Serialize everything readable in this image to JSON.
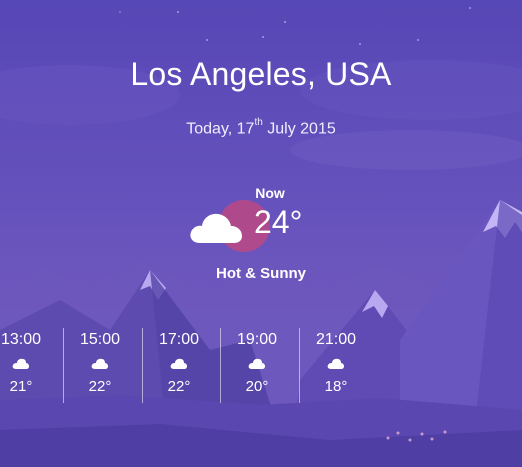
{
  "location": {
    "city": "Los Angeles, USA"
  },
  "date": {
    "prefix": "Today, 17",
    "suffix": "th",
    "rest": " July 2015"
  },
  "current": {
    "label": "Now",
    "temperature": "24°",
    "condition": "Hot & Sunny",
    "icon": "cloud-icon"
  },
  "hourly": [
    {
      "time": "13:00",
      "temp": "21°",
      "icon": "cloud-icon"
    },
    {
      "time": "15:00",
      "temp": "22°",
      "icon": "cloud-icon"
    },
    {
      "time": "17:00",
      "temp": "22°",
      "icon": "cloud-icon"
    },
    {
      "time": "19:00",
      "temp": "20°",
      "icon": "cloud-icon"
    },
    {
      "time": "21:00",
      "temp": "18°",
      "icon": "cloud-icon"
    }
  ],
  "colors": {
    "sky_top": "#5a4ab8",
    "sky_bottom": "#7a60c2",
    "mountain": "#6c55b6",
    "sun": "#c1477f",
    "text": "#ffffff"
  }
}
